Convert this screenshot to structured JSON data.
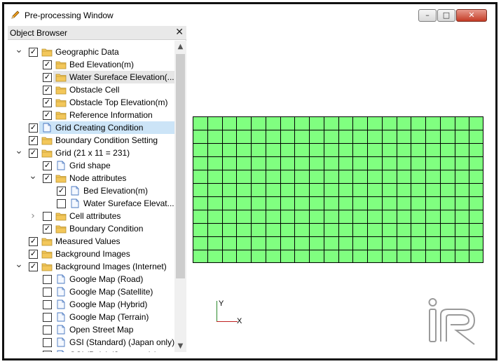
{
  "window": {
    "title": "Pre-processing Window",
    "title_icon": "pencil-icon",
    "controls": [
      {
        "name": "minimize",
        "glyph": "–"
      },
      {
        "name": "maximize",
        "glyph": "□"
      },
      {
        "name": "close",
        "glyph": "✕"
      }
    ]
  },
  "object_browser": {
    "title": "Object Browser",
    "close_glyph": "✕",
    "items": [
      {
        "label": "Geographic Data",
        "level": 0,
        "expander": "expanded",
        "checked": true,
        "icon": "folder-icon"
      },
      {
        "label": "Bed Elevation(m)",
        "level": 1,
        "expander": "none",
        "checked": true,
        "icon": "folder-icon"
      },
      {
        "label": "Water Sureface Elevation(...",
        "level": 1,
        "expander": "none",
        "checked": true,
        "icon": "folder-icon",
        "highlight": "gray"
      },
      {
        "label": "Obstacle Cell",
        "level": 1,
        "expander": "none",
        "checked": true,
        "icon": "folder-icon"
      },
      {
        "label": "Obstacle Top Elevation(m)",
        "level": 1,
        "expander": "none",
        "checked": true,
        "icon": "folder-icon"
      },
      {
        "label": "Reference Information",
        "level": 1,
        "expander": "none",
        "checked": true,
        "icon": "folder-icon"
      },
      {
        "label": "Grid Creating Condition",
        "level": 0,
        "expander": "none",
        "checked": true,
        "icon": "document-icon",
        "highlight": "blue"
      },
      {
        "label": "Boundary Condition Setting",
        "level": 0,
        "expander": "none",
        "checked": true,
        "icon": "folder-icon"
      },
      {
        "label": "Grid (21 x 11 = 231)",
        "level": 0,
        "expander": "expanded",
        "checked": true,
        "icon": "folder-icon"
      },
      {
        "label": "Grid shape",
        "level": 1,
        "expander": "none",
        "checked": true,
        "icon": "document-icon"
      },
      {
        "label": "Node attributes",
        "level": 1,
        "expander": "expanded",
        "checked": true,
        "icon": "folder-icon"
      },
      {
        "label": "Bed Elevation(m)",
        "level": 2,
        "expander": "none",
        "checked": true,
        "icon": "document-icon"
      },
      {
        "label": "Water Sureface Elevat...",
        "level": 2,
        "expander": "none",
        "checked": false,
        "icon": "document-icon"
      },
      {
        "label": "Cell attributes",
        "level": 1,
        "expander": "collapsed",
        "checked": false,
        "icon": "folder-icon"
      },
      {
        "label": "Boundary Condition",
        "level": 1,
        "expander": "none",
        "checked": true,
        "icon": "folder-icon"
      },
      {
        "label": "Measured Values",
        "level": 0,
        "expander": "none",
        "checked": true,
        "icon": "folder-icon"
      },
      {
        "label": "Background Images",
        "level": 0,
        "expander": "none",
        "checked": true,
        "icon": "folder-icon"
      },
      {
        "label": "Background Images (Internet)",
        "level": 0,
        "expander": "expanded",
        "checked": true,
        "icon": "folder-icon"
      },
      {
        "label": "Google Map (Road)",
        "level": 1,
        "expander": "none",
        "checked": false,
        "icon": "document-icon"
      },
      {
        "label": "Google Map (Satellite)",
        "level": 1,
        "expander": "none",
        "checked": false,
        "icon": "document-icon"
      },
      {
        "label": "Google Map (Hybrid)",
        "level": 1,
        "expander": "none",
        "checked": false,
        "icon": "document-icon"
      },
      {
        "label": "Google Map (Terrain)",
        "level": 1,
        "expander": "none",
        "checked": false,
        "icon": "document-icon"
      },
      {
        "label": "Open Street Map",
        "level": 1,
        "expander": "none",
        "checked": false,
        "icon": "document-icon"
      },
      {
        "label": "GSI (Standard) (Japan only)",
        "level": 1,
        "expander": "none",
        "checked": false,
        "icon": "document-icon"
      },
      {
        "label": "GSI (Pale) (Japan only)",
        "level": 1,
        "expander": "none",
        "checked": false,
        "icon": "document-icon"
      }
    ]
  },
  "canvas": {
    "grid": {
      "columns": 20,
      "rows": 11,
      "fill": "#80ff80",
      "line": "#000000"
    },
    "axes": {
      "y_label": "Y",
      "x_label": "X",
      "y_color": "#2a8a2a",
      "x_color": "#c02020"
    },
    "logo": "iric-logo"
  },
  "colors": {
    "selection_blue": "#cce4f7",
    "selection_gray": "#e6e6e6",
    "folder": "#f3c75a",
    "close_button": "#c43b25"
  }
}
